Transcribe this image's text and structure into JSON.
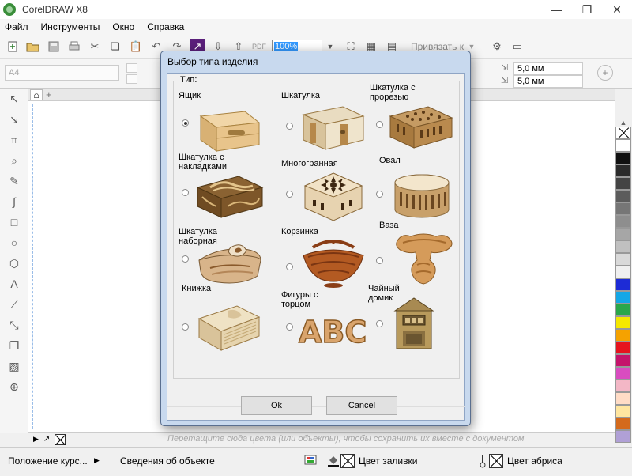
{
  "app": {
    "title": "CorelDRAW X8",
    "window_buttons": [
      "—",
      "❐",
      "✕"
    ]
  },
  "menu": [
    "Файл",
    "Инструменты",
    "Окно",
    "Справка"
  ],
  "toolbar": {
    "zoom": "100%",
    "snap_label": "Привязать к"
  },
  "propbar": {
    "page_size": "A4",
    "nudge_x": "5,0 мм",
    "nudge_y": "5,0 мм"
  },
  "doc_palette_hint": "Перетащите сюда цвета (или объекты), чтобы сохранить их вместе с документом",
  "status": {
    "cursor_position": "Положение курс...",
    "object_info": "Сведения об объекте",
    "fill_label": "Цвет заливки",
    "outline_label": "Цвет абриса"
  },
  "palette_colors": [
    "#ffffff",
    "#111111",
    "#2b2b2b",
    "#444444",
    "#5c5c5c",
    "#767676",
    "#8e8e8e",
    "#a6a6a6",
    "#c0c0c0",
    "#d9d9d9",
    "#f0f0f0",
    "#1d2bd6",
    "#14a7e6",
    "#2aa74a",
    "#f5e800",
    "#f5a200",
    "#e6141e",
    "#c5146b",
    "#d94cc0",
    "#f3b7c6",
    "#ffdcc6",
    "#ffe6a0",
    "#d46a1c",
    "#b0a0d6"
  ],
  "dialog": {
    "title": "Выбор типа изделия",
    "group_label": "Тип:",
    "ok_label": "Ok",
    "cancel_label": "Cancel",
    "options": [
      {
        "label": "Ящик",
        "checked": true
      },
      {
        "label": "Шкатулка",
        "checked": false
      },
      {
        "label": "Шкатулка с\nпрорезью",
        "checked": false
      },
      {
        "label": "Шкатулка с\nнакладками",
        "checked": false
      },
      {
        "label": "Многогранная",
        "checked": false
      },
      {
        "label": "Овал",
        "checked": false
      },
      {
        "label": "Шкатулка\nнаборная",
        "checked": false
      },
      {
        "label": "Корзинка",
        "checked": false
      },
      {
        "label": "Ваза",
        "checked": false
      },
      {
        "label": "Книжка",
        "checked": false
      },
      {
        "label": "Фигуры с\nторцом",
        "checked": false
      },
      {
        "label": "Чайный\nдомик",
        "checked": false
      }
    ],
    "abc_text": "ABC"
  }
}
